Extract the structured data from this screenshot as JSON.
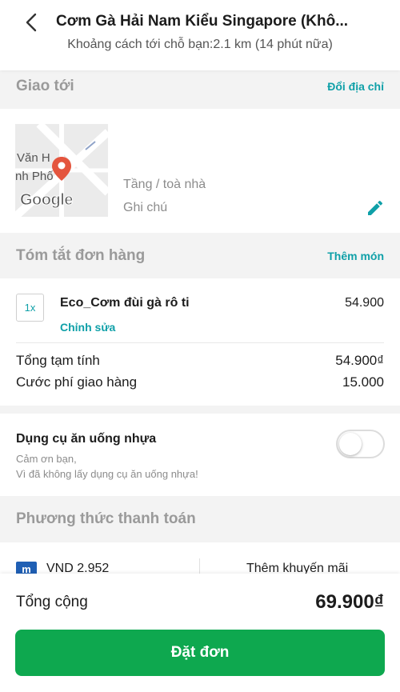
{
  "header": {
    "title": "Cơm Gà Hải Nam Kiểu Singapore (Khô...",
    "subtitle": "Khoảng cách tới chỗ bạn:2.1 km (14 phút nữa)",
    "back_icon": "chevron-left-icon"
  },
  "delivery": {
    "section_label": "Giao tới",
    "action_label": "Đổi địa chỉ",
    "map_labels": [
      "Văn H",
      "nh Phố"
    ],
    "map_logo": "Google",
    "building_placeholder": "Tầng / toà nhà",
    "note_placeholder": "Ghi chú",
    "edit_icon": "pencil-icon"
  },
  "summary": {
    "section_label": "Tóm tắt đơn hàng",
    "action_label": "Thêm món",
    "items": [
      {
        "qty": "1x",
        "name": "Eco_Cơm đùi gà rô ti",
        "edit_label": "Chỉnh sửa",
        "price": "54.900"
      }
    ],
    "subtotal_label": "Tổng tạm tính",
    "subtotal_value": "54.900₫",
    "delivery_fee_label": "Cước phí giao hàng",
    "delivery_fee_value": "15.000"
  },
  "utensils": {
    "title": "Dụng cụ ăn uống nhựa",
    "desc_line1": "Cảm ơn bạn,",
    "desc_line2": "Vì đã không lấy dụng cụ ăn uống nhựa!",
    "toggle_on": false
  },
  "payment": {
    "section_label": "Phương thức thanh toán",
    "method_icon_text": "m",
    "method_amount": "VND 2.952",
    "promo_label": "Thêm khuyến mãi"
  },
  "footer": {
    "total_label": "Tổng cộng",
    "total_value": "69.900₫",
    "order_button": "Đặt đơn"
  },
  "colors": {
    "accent_teal": "#0fa0a8",
    "primary_green": "#0ea84f",
    "pin_red": "#e4553e",
    "pay_blue": "#1f5fb4"
  }
}
